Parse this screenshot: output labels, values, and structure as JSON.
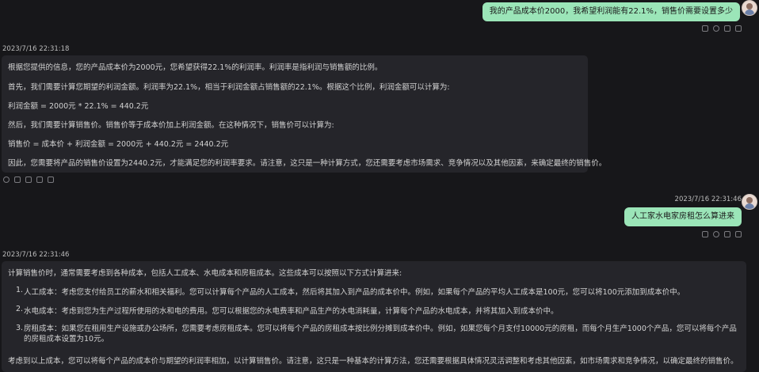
{
  "messages": [
    {
      "role": "user",
      "text": "我的产品成本价2000，我希望利润能有22.1%，销售价需要设置多少"
    },
    {
      "role": "assistant",
      "timestamp": "2023/7/16 22:31:18",
      "paragraphs": [
        "根据您提供的信息，您的产品成本价为2000元，您希望获得22.1%的利润率。利润率是指利润与销售额的比例。",
        "首先，我们需要计算您期望的利润金额。利润率为22.1%，相当于利润金额占销售额的22.1%。根据这个比例，利润金额可以计算为:",
        "利润金额 = 2000元 * 22.1% = 440.2元",
        "然后，我们需要计算销售价。销售价等于成本价加上利润金额。在这种情况下，销售价可以计算为:",
        "销售价 = 成本价 + 利润金额 = 2000元 + 440.2元 = 2440.2元",
        "因此，您需要将产品的销售价设置为2440.2元，才能满足您的利润率要求。请注意，这只是一种计算方式，您还需要考虑市场需求、竞争情况以及其他因素，来确定最终的销售价。"
      ]
    },
    {
      "role": "user",
      "timestamp": "2023/7/16 22:31:46",
      "text": "人工家水电家房租怎么算进来"
    },
    {
      "role": "assistant",
      "timestamp": "2023/7/16 22:31:46",
      "intro": "计算销售价时，通常需要考虑到各种成本，包括人工成本、水电成本和房租成本。这些成本可以按照以下方式计算进来:",
      "list": [
        "人工成本：考虑您支付给员工的薪水和相关福利。您可以计算每个产品的人工成本，然后将其加入到产品的成本价中。例如，如果每个产品的平均人工成本是100元，您可以将100元添加到成本价中。",
        "水电成本：考虑到您为生产过程所使用的水和电的费用。您可以根据您的水电费率和产品生产的水电消耗量，计算每个产品的水电成本，并将其加入到成本价中。",
        "房租成本：如果您在租用生产设施或办公场所，您需要考虑房租成本。您可以将每个产品的房租成本按比例分摊到成本价中。例如，如果您每个月支付10000元的房租，而每个月生产1000个产品，您可以将每个产品的房租成本设置为10元。"
      ],
      "outro": "考虑到以上成本，您可以将每个产品的成本价与期望的利润率相加，以计算销售价。请注意，这只是一种基本的计算方法，您还需要根据具体情况灵活调整和考虑其他因素，如市场需求和竞争情况，以确定最终的销售价。"
    }
  ],
  "icons": {
    "user_actions": [
      "edit-icon",
      "refresh-icon",
      "copy-icon",
      "delete-icon"
    ],
    "bot_actions": [
      "refresh-icon",
      "copy-icon",
      "copy-icon",
      "save-icon",
      "delete-icon"
    ]
  }
}
